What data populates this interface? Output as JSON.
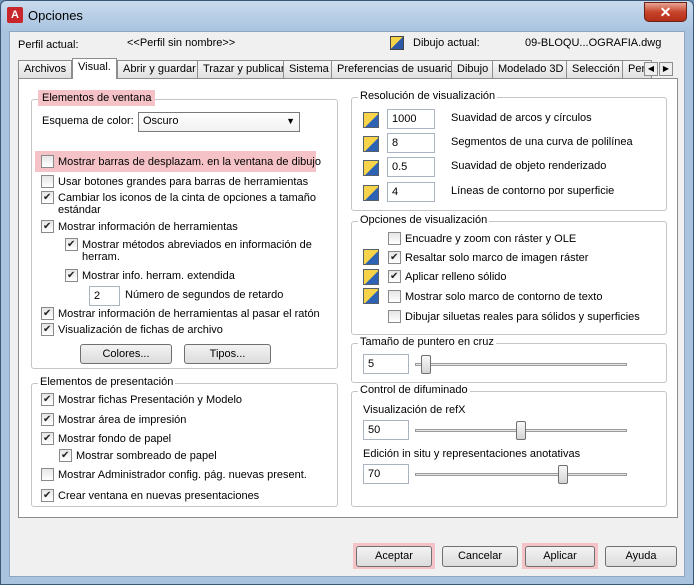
{
  "window": {
    "title": "Opciones",
    "app_icon_letter": "A"
  },
  "profile": {
    "label": "Perfil actual:",
    "value": "<<Perfil sin nombre>>",
    "drawing_label": "Dibujo actual:",
    "drawing_value": "09-BLOQU...OGRAFIA.dwg"
  },
  "tabs": [
    "Archivos",
    "Visual.",
    "Abrir y guardar",
    "Trazar y publicar",
    "Sistema",
    "Preferencias de usuario",
    "Dibujo",
    "Modelado 3D",
    "Selección",
    "Per"
  ],
  "window_elements": {
    "title": "Elementos de ventana",
    "color_scheme_label": "Esquema de color:",
    "color_scheme_value": "Oscuro",
    "options": [
      {
        "label": "Mostrar barras de desplazam. en la ventana de dibujo",
        "checked": false
      },
      {
        "label": "Usar botones grandes para barras de herramientas",
        "checked": false
      },
      {
        "label": "Cambiar los iconos de la cinta de opciones a tamaño",
        "label2": "estándar",
        "checked": true
      },
      {
        "label": "Mostrar información de herramientas",
        "checked": true
      },
      {
        "label": "Mostrar métodos abreviados en información de",
        "label2": "herram.",
        "checked": true
      },
      {
        "label": "Mostrar info. herram. extendida",
        "checked": true
      },
      {
        "label": "Mostrar información de herramientas al pasar el ratón",
        "checked": true
      },
      {
        "label": "Visualización de fichas de archivo",
        "checked": true
      }
    ],
    "delay_value": "2",
    "delay_label": "Número de segundos de retardo",
    "colors_button": "Colores...",
    "fonts_button": "Tipos..."
  },
  "layout_elements": {
    "title": "Elementos de presentación",
    "options": [
      {
        "label": "Mostrar fichas Presentación y Modelo",
        "checked": true
      },
      {
        "label": "Mostrar área de impresión",
        "checked": true
      },
      {
        "label": "Mostrar fondo de papel",
        "checked": true
      },
      {
        "label": "Mostrar sombreado de papel",
        "checked": true
      },
      {
        "label": "Mostrar Administrador config. pág. nuevas present.",
        "checked": false
      },
      {
        "label": "Crear ventana en nuevas presentaciones",
        "checked": true
      }
    ]
  },
  "resolution": {
    "title": "Resolución de visualización",
    "rows": [
      {
        "value": "1000",
        "label": "Suavidad de arcos y círculos"
      },
      {
        "value": "8",
        "label": "Segmentos de una curva de polilínea"
      },
      {
        "value": "0.5",
        "label": "Suavidad de objeto renderizado"
      },
      {
        "value": "4",
        "label": "Líneas de contorno por superficie"
      }
    ]
  },
  "display_options": {
    "title": "Opciones de visualización",
    "options": [
      {
        "label": "Encuadre y zoom con ráster y OLE",
        "checked": false,
        "icon": false
      },
      {
        "label": "Resaltar solo marco de imagen ráster",
        "checked": true,
        "icon": true
      },
      {
        "label": "Aplicar relleno sólido",
        "checked": true,
        "icon": true
      },
      {
        "label": "Mostrar solo marco de contorno de texto",
        "checked": false,
        "icon": true
      },
      {
        "label": "Dibujar siluetas reales para sólidos y superficies",
        "checked": false,
        "icon": false
      }
    ]
  },
  "crosshair": {
    "title": "Tamaño de puntero en cruz",
    "value": "5",
    "level_pct": 5
  },
  "fade": {
    "title": "Control de difuminado",
    "xref_label": "Visualización de refX",
    "xref_value": "50",
    "xref_level_pct": 50,
    "inplace_label": "Edición in situ y representaciones anotativas",
    "inplace_value": "70",
    "inplace_level_pct": 70
  },
  "footer": {
    "accept": "Aceptar",
    "cancel": "Cancelar",
    "apply": "Aplicar",
    "help": "Ayuda"
  }
}
